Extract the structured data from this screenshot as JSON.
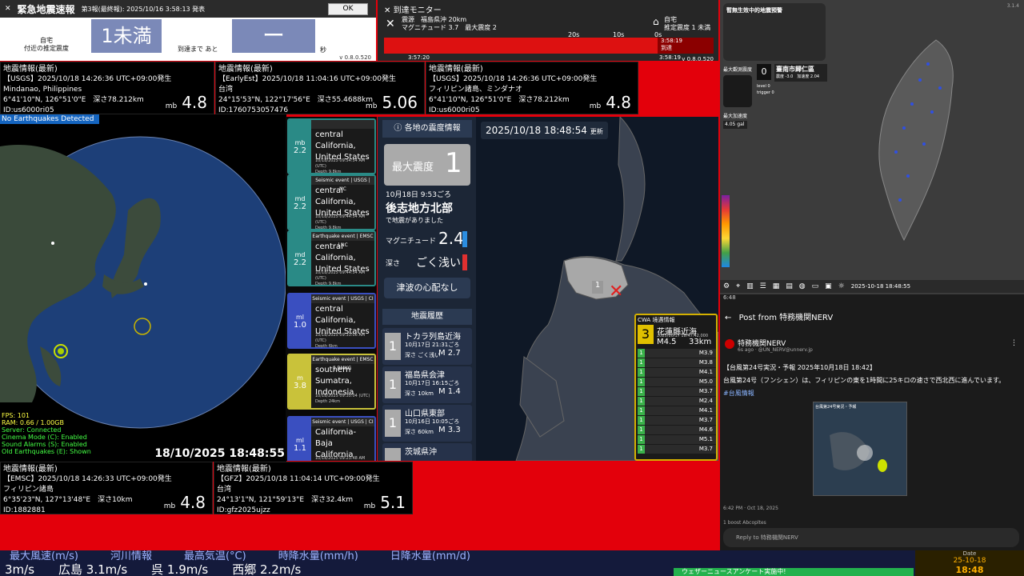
{
  "eew": {
    "title": "緊急地震速報",
    "subtitle": "第3報(最終報): 2025/10/16 3:58:13 発表",
    "ok": "OK",
    "loc_line1": "自宅",
    "loc_line2": "付近の推定震度",
    "intensity": "1未満",
    "until_label": "到達まで あと",
    "countdown": "ー",
    "sec_unit": "秒",
    "version": "v 0.8.0.520"
  },
  "arrival": {
    "title": "到達モニター",
    "epicenter": "震源　福島県沖 20km",
    "mag_line": "マグニチュード 3.7　最大震度 2",
    "home_line1": "自宅",
    "home_line2": "推定震度 1 未満",
    "ticks": [
      "20s",
      "10s",
      "0s"
    ],
    "time_start": "3:57:20",
    "time_end": "3:58:19",
    "marker_time": "3:58:19",
    "marker_label": "到達",
    "version": "v 0.8.0.520"
  },
  "quakes_top": [
    {
      "title": "地震情報(最新)",
      "line1": "【USGS】2025/10/18 14:26:36 UTC+09:00発生",
      "line2": "Mindanao, Philippines",
      "line3": "6°41'10\"N, 126°51'0\"E　深さ78.212km",
      "id": "ID:us6000ri05",
      "mb_label": "mb",
      "mag": "4.8"
    },
    {
      "title": "地震情報(最新)",
      "line1": "【EarlyEst】2025/10/18 11:04:16 UTC+09:00発生",
      "line2": "台湾",
      "line3": "24°15'53\"N, 122°17'56\"E　深さ55.4688km",
      "id": "ID:1760753057476",
      "mb_label": "mb",
      "mag": "5.06"
    },
    {
      "title": "地震情報(最新)",
      "line1": "【USGS】2025/10/18 14:26:36 UTC+09:00発生",
      "line2": "フィリピン諸島、ミンダナオ",
      "line3": "6°41'10\"N, 126°51'0\"E　深さ78.212km",
      "id": "ID:us6000ri05",
      "mb_label": "mb",
      "mag": "4.8"
    }
  ],
  "quakes_bottom": [
    {
      "title": "地震情報(最新)",
      "line1": "【EMSC】2025/10/18 14:26:33 UTC+09:00発生",
      "line2": "フィリピン諸島",
      "line3": "6°35'23\"N, 127°13'48\"E　深さ10km",
      "id": "ID:1882881",
      "mb_label": "mb",
      "mag": "4.8"
    },
    {
      "title": "地震情報(最新)",
      "line1": "【GFZ】2025/10/18 11:04:14 UTC+09:00発生",
      "line2": "台湾",
      "line3": "24°13'1\"N, 121°59'13\"E　深さ32.4km",
      "id": "ID:gfz2025ujzz",
      "mb_label": "mb",
      "mag": "5.1"
    }
  ],
  "globe": {
    "banner": "No Earthquakes Detected",
    "timestamp": "18/10/2025 18:48:55",
    "status": [
      "FPS: 101",
      "RAM: 0.66 / 1.00GB",
      "Server: Connected",
      "Cinema Mode (C): Enabled",
      "Sound Alarms (S): Enabled",
      "Old Earthquakes (E): Shown"
    ]
  },
  "event_cards": [
    {
      "caption": "",
      "mag_label": "mb",
      "mag": "2.2",
      "place": "central California, United States",
      "date": "10/18/2025 09:54:54 AM (UTC)",
      "depth": "Depth 9.8km",
      "color": "#2a8a86"
    },
    {
      "caption": "Seismic event | USGS | NC",
      "mag_label": "md",
      "mag": "2.2",
      "place": "central California, United States",
      "date": "10/18/2025 09:44:54 AM (UTC)",
      "depth": "Depth 9.8km",
      "color": "#2a8a86"
    },
    {
      "caption": "Earthquake event | EMSC | NC",
      "mag_label": "md",
      "mag": "2.2",
      "place": "central California, United States",
      "date": "10/18/2025 09:44:54 AM (UTC)",
      "depth": "Depth 9.8km",
      "color": "#2a8a86"
    },
    {
      "caption": "Seismic event | USGS | CI",
      "mag_label": "ml",
      "mag": "1.0",
      "place": "central California, United States",
      "date": "10/18/2025 09:33:06 AM (UTC)",
      "depth": "Depth 6km",
      "color": "#3a4fc0"
    },
    {
      "caption": "Earthquake event | EMSC | BMKG",
      "mag_label": "m",
      "mag": "3.8",
      "place": "southern Sumatra, Indonesia",
      "date": "10/18/2025 09:35:04 (UTC)",
      "depth": "Depth 24km",
      "color": "#c9c23a"
    },
    {
      "caption": "Seismic event | USGS | CI",
      "mag_label": "ml",
      "mag": "1.1",
      "place": "California-Baja California border",
      "date": "10/18/2025 09:23:48 AM (UTC)",
      "depth": "",
      "color": "#3a4fc0"
    }
  ],
  "jp_panel": {
    "title": "各地の震度情報",
    "max_label": "最大震度",
    "max_value": "1",
    "time": "10月18日 9:53ごろ",
    "region": "後志地方北部",
    "region_sub": "で地震がありました",
    "mag_label": "マグニチュード",
    "mag_value": "2.4",
    "depth_label": "深さ",
    "depth_value": "ごく浅い",
    "tsunami": "津波の心配なし",
    "history_title": "地震履歴",
    "history": [
      {
        "intensity": "1",
        "place": "トカラ列島近海",
        "time": "10月17日 21:31ごろ",
        "depth": "深さ ごく浅い",
        "mag": "M 2.7"
      },
      {
        "intensity": "1",
        "place": "福島県会津",
        "time": "10月17日 16:15ごろ",
        "depth": "深さ 10km",
        "mag": "M 1.4"
      },
      {
        "intensity": "1",
        "place": "山口県東部",
        "time": "10月16日 10:05ごろ",
        "depth": "深さ 60km",
        "mag": "M 3.3"
      },
      {
        "intensity": "",
        "place": "茨城県沖",
        "time": "",
        "depth": "",
        "mag": ""
      }
    ]
  },
  "jp_map": {
    "timestamp": "2025/10/18 18:48:54",
    "update_label": "更新",
    "epicenter_intensity": "1"
  },
  "cwa": {
    "title": "CWA 境遇情報",
    "intensity": "3",
    "place": "花蓮縣近海",
    "date": "2025/10/17 18:47:42.000",
    "mag": "M4.5",
    "depth": "33km",
    "list": [
      {
        "level": "1",
        "mag": "M3.9"
      },
      {
        "level": "1",
        "mag": "M3.8"
      },
      {
        "level": "1",
        "mag": "M4.1"
      },
      {
        "level": "1",
        "mag": "M5.0"
      },
      {
        "level": "1",
        "mag": "M3.7"
      },
      {
        "level": "1",
        "mag": "M2.4"
      },
      {
        "level": "1",
        "mag": "M4.1"
      },
      {
        "level": "1",
        "mag": "M3.7"
      },
      {
        "level": "1",
        "mag": "M4.6"
      },
      {
        "level": "1",
        "mag": "M5.1"
      },
      {
        "level": "1",
        "mag": "M3.7"
      }
    ]
  },
  "taiwan": {
    "title": "暫無生效中的地震預警",
    "max_label": "最大觀測震度",
    "max_value": "0",
    "station": "臺南市歸仁區",
    "station_detail": "震度 -3.0　加速度 2.04",
    "level_label": "level",
    "trigger_label": "trigger",
    "level_value": "0",
    "trigger_value": "0",
    "max_pga_label": "最大加速度",
    "pga": "4.05 gal",
    "legend": [
      "7",
      "6",
      "5",
      "4",
      "3",
      "2",
      "1",
      "0"
    ],
    "timestamp": "2025-10-18 18:48:55",
    "version": "3.1.4"
  },
  "post": {
    "status_time": "6:48",
    "header": "Post from 特務機関NERV",
    "name": "特務機関NERV",
    "handle": "6s ago · @UN_NERV@unnerv.jp",
    "line1": "【台風第24号実況・予報 2025年10月18日 18:42】",
    "line2": "台風第24号（フンシェン）は、フィリピンの東を1時間に25キロの速さで西北西に進んでいます。",
    "tag": "#台風情報",
    "image_title": "台風第24号実況・予報",
    "footer_time": "6:42 PM · Oct 18, 2025",
    "reply": "Reply to 特務機関NERV",
    "counts": "1 boost  Abcopltes"
  },
  "ticker": {
    "row1": [
      "最大風速(m/s)",
      "河川情報",
      "最高気温(°C)",
      "時降水量(mm/h)",
      "日降水量(mm/d)"
    ],
    "row2": "3m/s　　広島 3.1m/s　　呉 1.9m/s　　西郷 2.2m/s",
    "news": "ウェザーニュースアンケート実施中!",
    "date_label": "Date",
    "date": "25-10-18",
    "time": "18:48"
  }
}
